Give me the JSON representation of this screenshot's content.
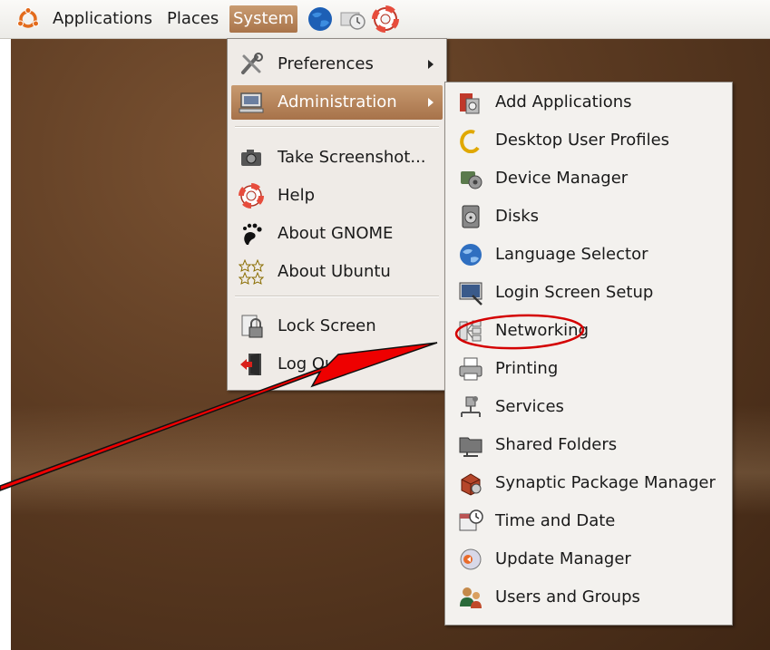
{
  "panel": {
    "menus": [
      {
        "label": "Applications"
      },
      {
        "label": "Places"
      },
      {
        "label": "System"
      }
    ]
  },
  "system_menu": {
    "items": [
      {
        "label": "Preferences",
        "icon": "preferences-icon",
        "has_submenu": true
      },
      {
        "label": "Administration",
        "icon": "administration-icon",
        "has_submenu": true,
        "highlighted": true
      },
      {
        "label": "Take Screenshot...",
        "icon": "camera-icon"
      },
      {
        "label": "Help",
        "icon": "help-lifebuoy-icon"
      },
      {
        "label": "About GNOME",
        "icon": "gnome-foot-icon"
      },
      {
        "label": "About Ubuntu",
        "icon": "ubuntu-stars-icon"
      },
      {
        "label": "Lock Screen",
        "icon": "lock-icon"
      },
      {
        "label": "Log Out",
        "icon": "logout-icon"
      }
    ]
  },
  "admin_menu": {
    "items": [
      {
        "label": "Add Applications",
        "icon": "add-applications-icon"
      },
      {
        "label": "Desktop User Profiles",
        "icon": "user-profiles-icon"
      },
      {
        "label": "Device Manager",
        "icon": "device-manager-icon"
      },
      {
        "label": "Disks",
        "icon": "disks-icon"
      },
      {
        "label": "Language Selector",
        "icon": "globe-icon"
      },
      {
        "label": "Login Screen Setup",
        "icon": "login-screen-icon"
      },
      {
        "label": "Networking",
        "icon": "networking-icon",
        "circled": true
      },
      {
        "label": "Printing",
        "icon": "printer-icon"
      },
      {
        "label": "Services",
        "icon": "services-icon"
      },
      {
        "label": "Shared Folders",
        "icon": "shared-folders-icon"
      },
      {
        "label": "Synaptic Package Manager",
        "icon": "synaptic-icon"
      },
      {
        "label": "Time and Date",
        "icon": "clock-calendar-icon"
      },
      {
        "label": "Update Manager",
        "icon": "update-manager-icon"
      },
      {
        "label": "Users and Groups",
        "icon": "users-groups-icon"
      }
    ]
  },
  "colors": {
    "highlight": "#b07c52",
    "annotation_red": "#e00000",
    "desktop": "#5c3b22"
  }
}
